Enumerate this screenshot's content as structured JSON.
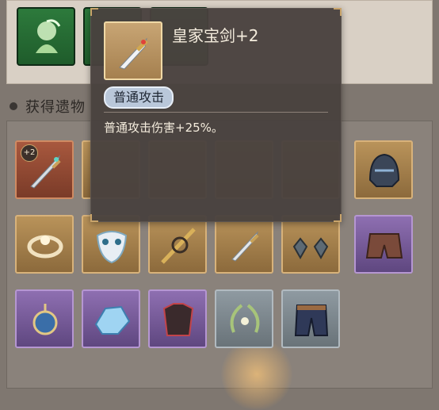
{
  "section": {
    "title": "获得遗物"
  },
  "skills": {
    "icons": [
      "leaf-spirit-icon",
      "skill-icon",
      "skill-icon"
    ],
    "color": "#2d7a3c"
  },
  "tooltip": {
    "name": "皇家宝剑+2",
    "tag": "普通攻击",
    "description": "普通攻击伤害+25%。",
    "icon": "royal-sword-icon"
  },
  "relics": [
    {
      "icon": "sword-icon",
      "rarity": "red",
      "badge": "+2"
    },
    {
      "icon": "unknown-icon",
      "rarity": "gold"
    },
    {
      "icon": "unknown-icon",
      "rarity": "gold"
    },
    {
      "icon": "unknown-icon",
      "rarity": "gold"
    },
    {
      "icon": "unknown-icon",
      "rarity": "gold"
    },
    {
      "icon": "helmet-icon",
      "rarity": "gold"
    },
    {
      "icon": "ring-icon",
      "rarity": "gold"
    },
    {
      "icon": "mask-icon",
      "rarity": "gold"
    },
    {
      "icon": "spear-icon",
      "rarity": "gold"
    },
    {
      "icon": "dagger-icon",
      "rarity": "gold",
      "highlighted": true
    },
    {
      "icon": "earrings-icon",
      "rarity": "gold"
    },
    {
      "icon": "shorts-icon",
      "rarity": "purple"
    },
    {
      "icon": "amulet-icon",
      "rarity": "purple"
    },
    {
      "icon": "crystal-icon",
      "rarity": "purple"
    },
    {
      "icon": "armor-icon",
      "rarity": "purple"
    },
    {
      "icon": "laurel-icon",
      "rarity": "gray"
    },
    {
      "icon": "pants-icon",
      "rarity": "gray"
    }
  ]
}
